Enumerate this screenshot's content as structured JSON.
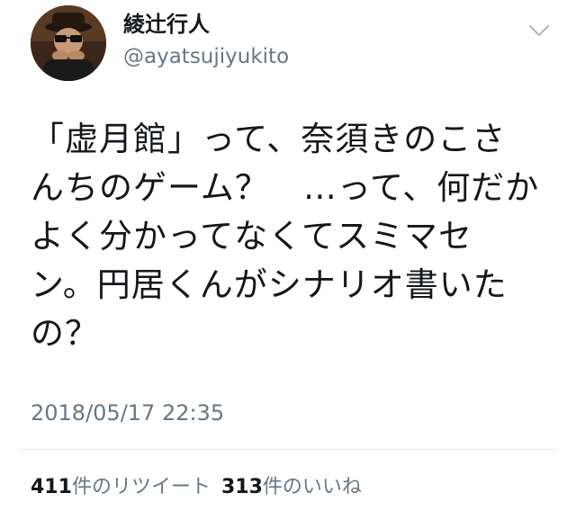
{
  "tweet": {
    "display_name": "綾辻行人",
    "handle": "@ayatsujiyukito",
    "text_lines": [
      "「虚月館」って、奈須きのこさ",
      "んちのゲーム？　…って、何だか",
      "よく分かってなくてスミマセ",
      "ン。円居くんがシナリオ書いた",
      "の？"
    ],
    "timestamp": "2018/05/17 22:35",
    "retweets": {
      "count": "411",
      "label": "件のリツイート"
    },
    "likes": {
      "count": "313",
      "label": "件のいいね"
    }
  },
  "icons": {
    "menu": "chevron-down-icon",
    "avatar": "avatar-photo"
  },
  "colors": {
    "text": "#14171a",
    "secondary": "#657786",
    "divider": "#e1e8ed"
  }
}
